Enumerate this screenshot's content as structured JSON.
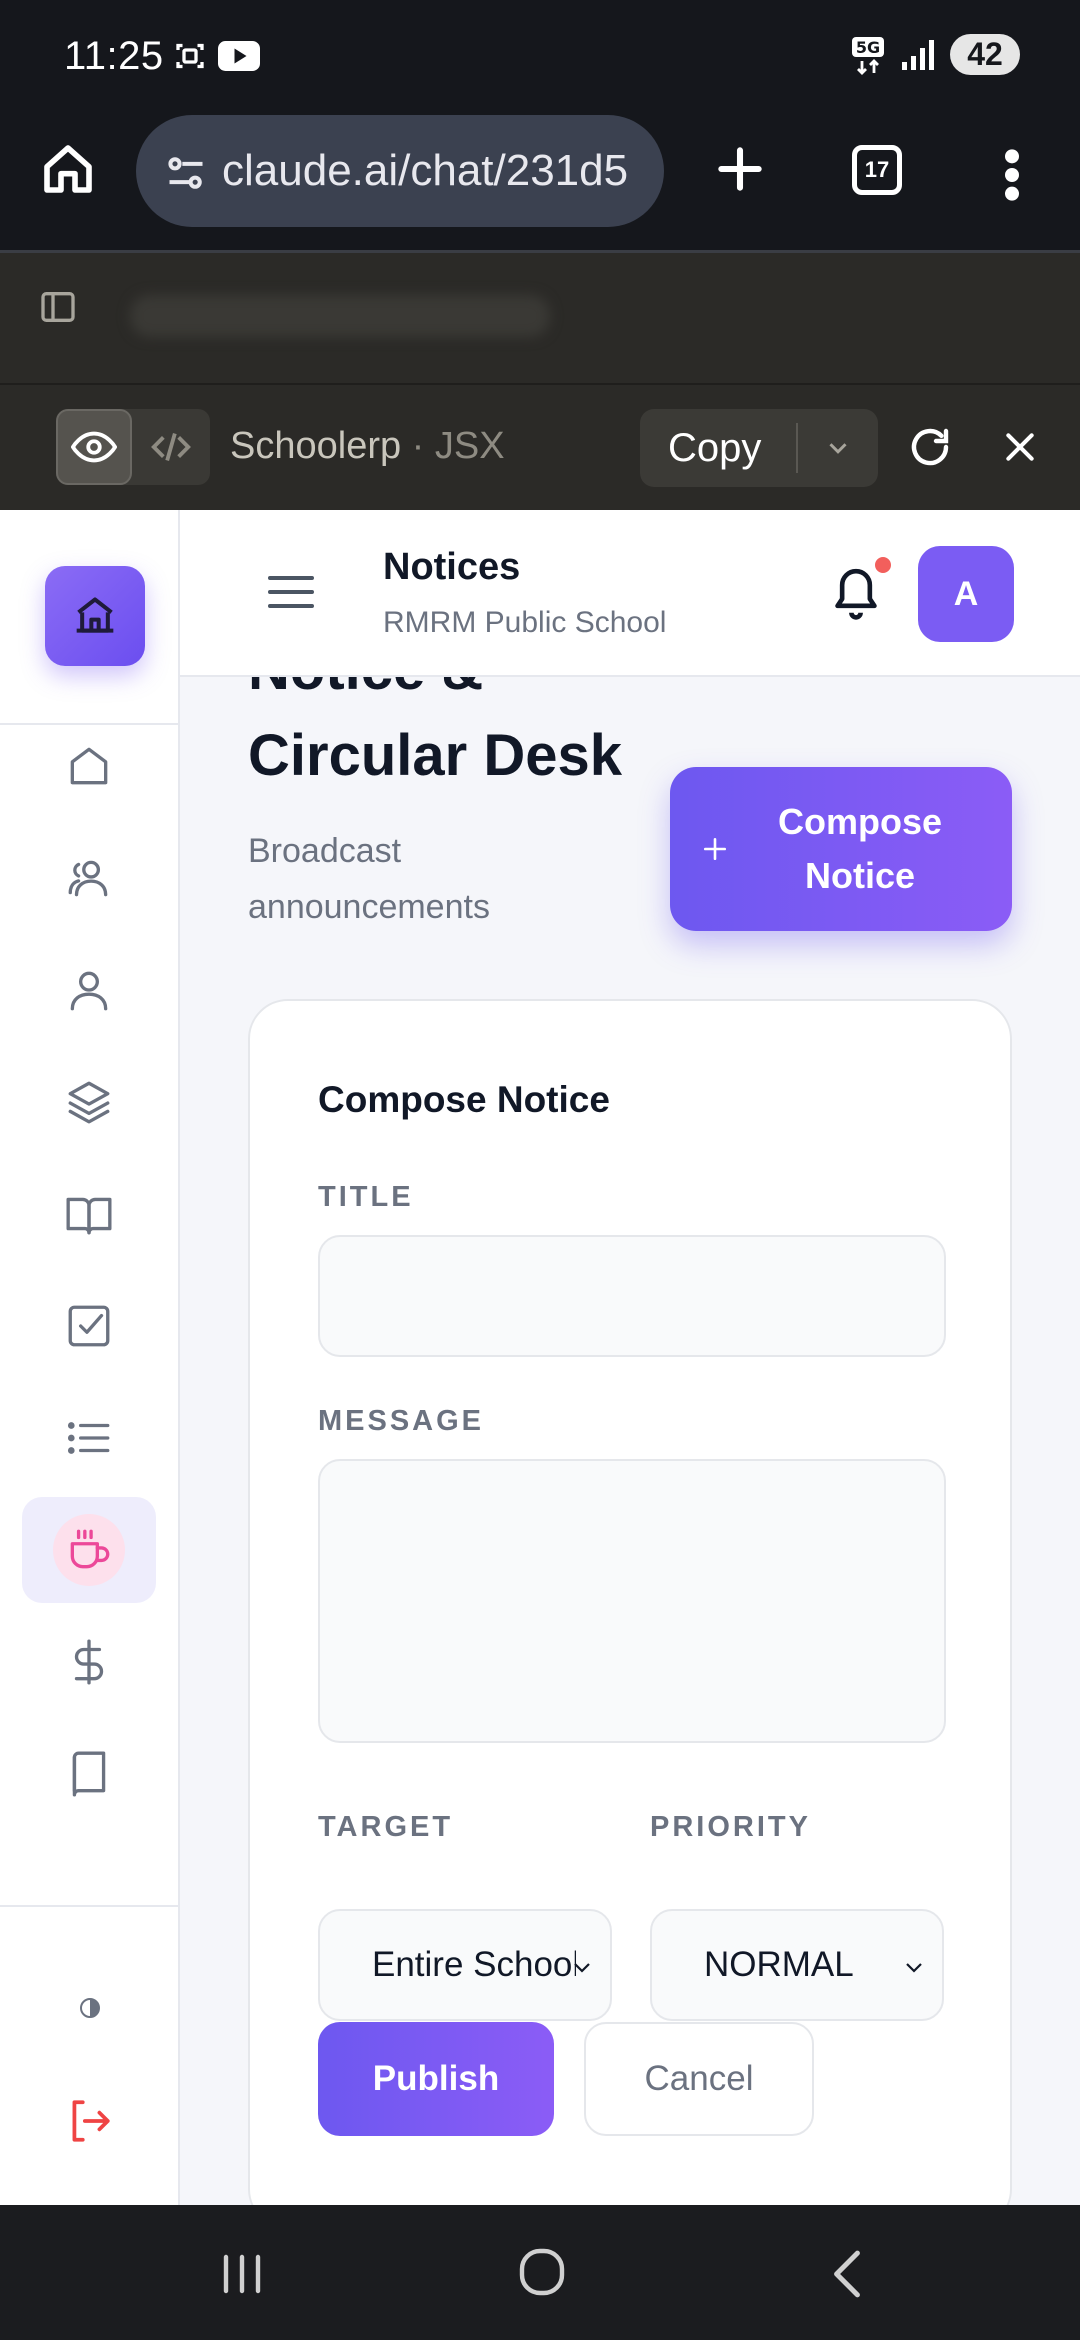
{
  "status_bar": {
    "time": "11:25",
    "network": "5G",
    "battery": "42",
    "icons": [
      "screenshot-icon",
      "youtube-icon",
      "network-5g-icon",
      "signal-icon"
    ]
  },
  "browser": {
    "url": "claude.ai/chat/231d5",
    "tab_count": "17"
  },
  "artifact": {
    "name": "Schoolerp",
    "separator": " · ",
    "type": "JSX",
    "copy_label": "Copy"
  },
  "app": {
    "header": {
      "title": "Notices",
      "subtitle": "RMRM Public School",
      "avatar_initial": "A",
      "has_unread_notification": true
    },
    "sidebar": {
      "items": [
        {
          "name": "home",
          "icon": "home-icon",
          "active": false
        },
        {
          "name": "users",
          "icon": "users-icon",
          "active": false
        },
        {
          "name": "profile",
          "icon": "user-icon",
          "active": false
        },
        {
          "name": "classes",
          "icon": "layers-icon",
          "active": false
        },
        {
          "name": "subjects",
          "icon": "book-open-icon",
          "active": false
        },
        {
          "name": "attendance",
          "icon": "check-square-icon",
          "active": false
        },
        {
          "name": "list",
          "icon": "list-icon",
          "active": false
        },
        {
          "name": "notices",
          "icon": "coffee-icon",
          "active": true
        },
        {
          "name": "fees",
          "icon": "dollar-icon",
          "active": false
        },
        {
          "name": "library",
          "icon": "book-icon",
          "active": false
        }
      ]
    },
    "page": {
      "title": "Notice & Circular Desk",
      "subtitle": "Broadcast announcements",
      "compose_cta_label": "Compose Notice"
    },
    "form": {
      "title": "Compose Notice",
      "title_label": "TITLE",
      "title_value": "",
      "message_label": "MESSAGE",
      "message_value": "",
      "target_label": "TARGET",
      "target_value": "Entire School",
      "priority_label": "PRIORITY",
      "priority_value": "NORMAL",
      "publish_label": "Publish",
      "cancel_label": "Cancel"
    }
  },
  "colors": {
    "accent": "#7b5cf3",
    "accent_gradient_end": "#8b5cf6",
    "notification_dot": "#f25f5c",
    "logout": "#ef4444",
    "active_nav_icon": "#ec4899"
  }
}
